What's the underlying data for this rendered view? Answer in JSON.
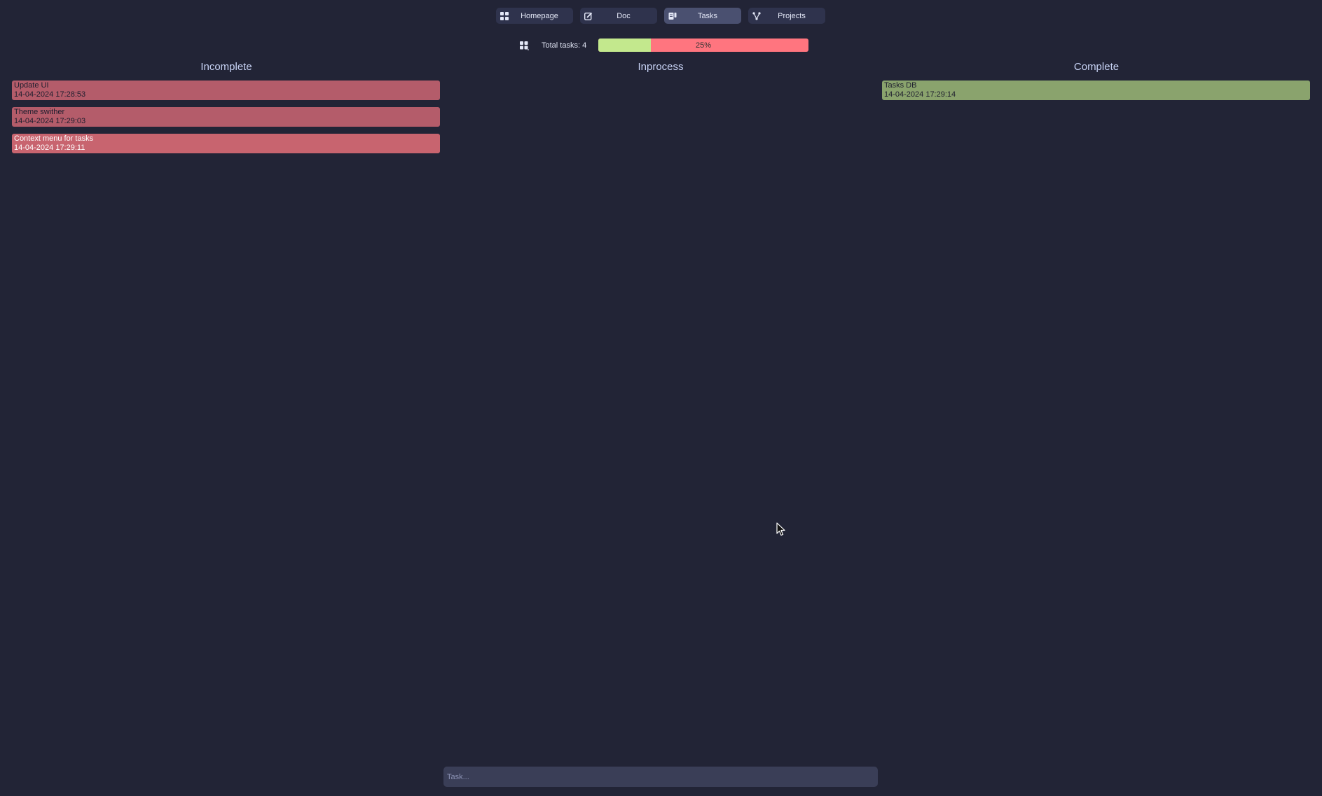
{
  "nav": {
    "items": [
      {
        "label": "Homepage",
        "icon": "grid-icon",
        "active": false
      },
      {
        "label": "Doc",
        "icon": "edit-icon",
        "active": false
      },
      {
        "label": "Tasks",
        "icon": "tasks-icon",
        "active": true
      },
      {
        "label": "Projects",
        "icon": "graph-icon",
        "active": false
      }
    ]
  },
  "stats": {
    "icon": "grid-icon",
    "total_label": "Total tasks: 4",
    "progress_percent_label": "25%",
    "progress_fraction": 0.25
  },
  "columns": {
    "incomplete": {
      "title": "Incomplete",
      "tasks": [
        {
          "name": "Update UI",
          "date": "14-04-2024 17:28:53"
        },
        {
          "name": "Theme swither",
          "date": "14-04-2024 17:29:03"
        },
        {
          "name": "Context menu for tasks",
          "date": "14-04-2024 17:29:11"
        }
      ]
    },
    "inprocess": {
      "title": "Inprocess",
      "tasks": []
    },
    "complete": {
      "title": "Complete",
      "tasks": [
        {
          "name": "Tasks DB",
          "date": "14-04-2024 17:29:14"
        }
      ]
    }
  },
  "input": {
    "placeholder": "Task...",
    "value": ""
  },
  "colors": {
    "background": "#222436",
    "incomplete_card": "#b45c6a",
    "complete_card": "#8aa36d",
    "progress_done": "#c3e88d",
    "progress_remaining": "#ff757f"
  }
}
